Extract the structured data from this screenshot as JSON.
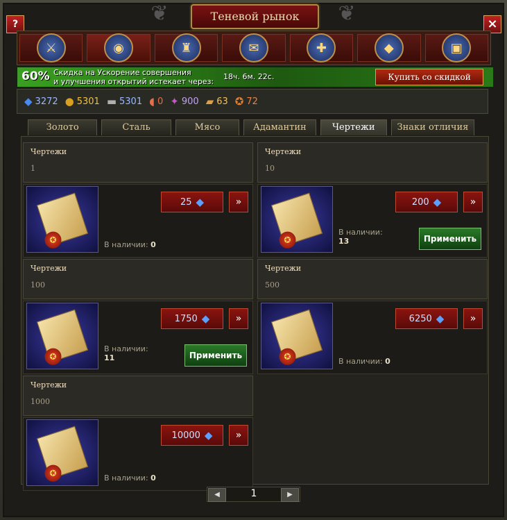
{
  "window": {
    "title": "Теневой рынок",
    "help": "?",
    "close": "×"
  },
  "categories": [
    {
      "icon": "crossed-swords-shield-icon",
      "glyph": "⚔"
    },
    {
      "icon": "resources-icon",
      "glyph": "◉"
    },
    {
      "icon": "knight-helmet-icon",
      "glyph": "♜"
    },
    {
      "icon": "scroll-icon",
      "glyph": "✉"
    },
    {
      "icon": "medical-banner-icon",
      "glyph": "✚"
    },
    {
      "icon": "crystal-icon",
      "glyph": "◆"
    },
    {
      "icon": "treasure-chest-icon",
      "glyph": "▣"
    }
  ],
  "promo": {
    "percent": "60%",
    "line1": "Скидка на Ускорение совершения",
    "line2": "и улучшения открытий истекает через:",
    "timer": "18ч. 6м. 22с.",
    "buy_label": "Купить со скидкой"
  },
  "resources": [
    {
      "icon": "crystal-icon",
      "glyph": "◆",
      "value": "3272",
      "color": "#9ab8ff"
    },
    {
      "icon": "gold-coin-icon",
      "glyph": "●",
      "value": "5301",
      "color": "#f0c040"
    },
    {
      "icon": "steel-ingot-icon",
      "glyph": "▬",
      "value": "5301",
      "color": "#9ab8ff"
    },
    {
      "icon": "meat-icon",
      "glyph": "◖",
      "value": "0",
      "color": "#f06a40"
    },
    {
      "icon": "adamantine-icon",
      "glyph": "✦",
      "value": "900",
      "color": "#c0a0f0"
    },
    {
      "icon": "blueprint-icon",
      "glyph": "▰",
      "value": "63",
      "color": "#f0c060"
    },
    {
      "icon": "insignia-icon",
      "glyph": "✪",
      "value": "72",
      "color": "#f08040"
    }
  ],
  "tabs": [
    "Золото",
    "Сталь",
    "Мясо",
    "Адамантин",
    "Чертежи",
    "Знаки отличия"
  ],
  "items": [
    {
      "name": "Чертежи",
      "qty": "1",
      "price": "25",
      "avail_label": "В наличии:",
      "avail": "0",
      "more": "»"
    },
    {
      "name": "Чертежи",
      "qty": "10",
      "price": "200",
      "avail_label": "В наличии:",
      "avail": "13",
      "more": "»",
      "apply": "Применить"
    },
    {
      "name": "Чертежи",
      "qty": "100",
      "price": "1750",
      "avail_label": "В наличии:",
      "avail": "11",
      "more": "»",
      "apply": "Применить"
    },
    {
      "name": "Чертежи",
      "qty": "500",
      "price": "6250",
      "avail_label": "В наличии:",
      "avail": "0",
      "more": "»"
    },
    {
      "name": "Чертежи",
      "qty": "1000",
      "price": "10000",
      "avail_label": "В наличии:",
      "avail": "0",
      "more": "»"
    }
  ],
  "pager": {
    "prev": "◀",
    "page": "1",
    "next": "▶"
  }
}
